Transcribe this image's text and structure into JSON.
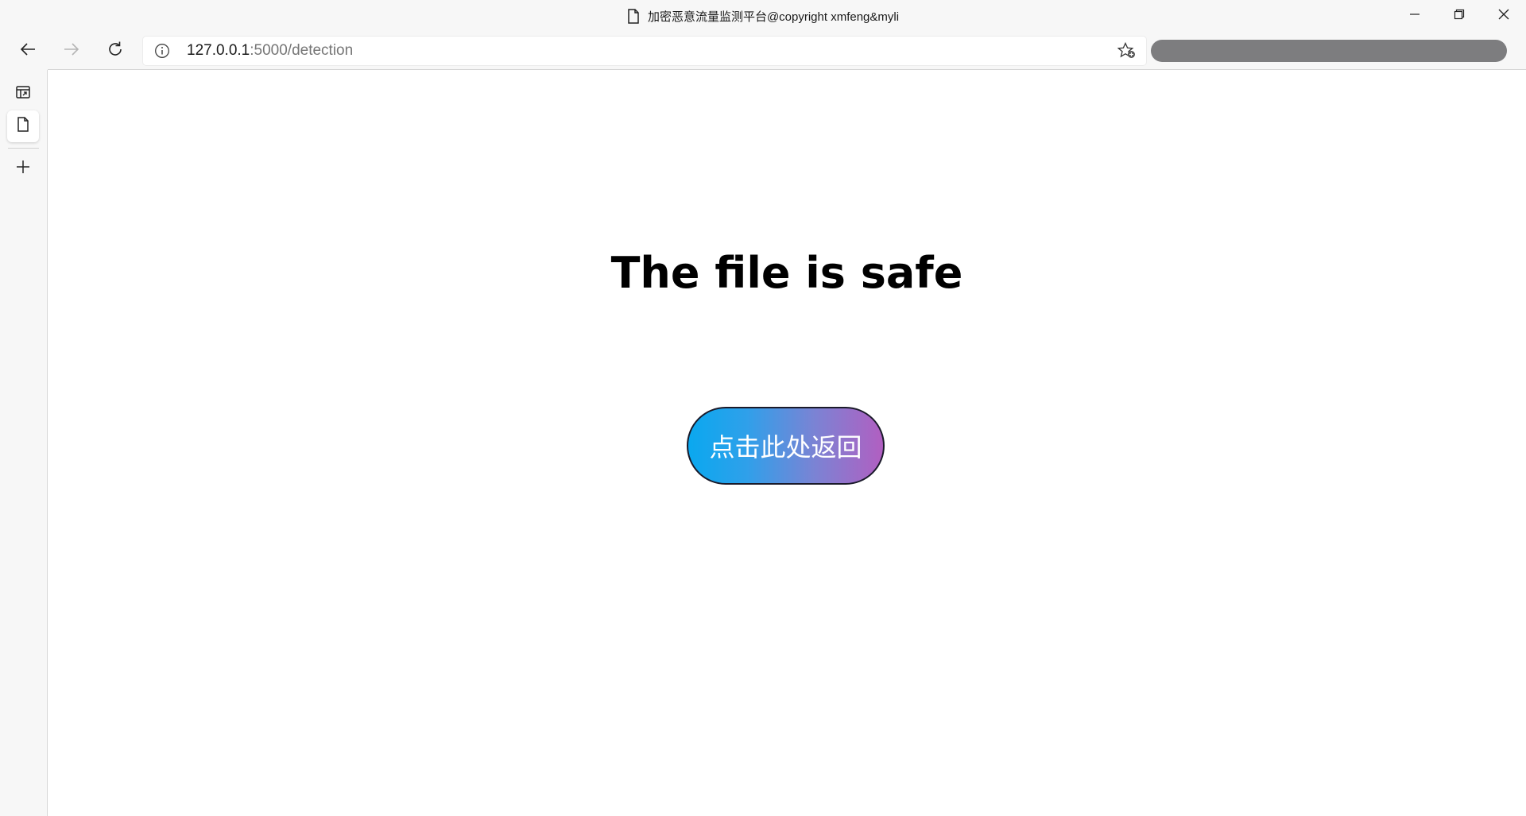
{
  "window": {
    "title": "加密恶意流量监测平台@copyright xmfeng&myli",
    "page_icon": "document-icon",
    "controls": [
      "minimize-icon",
      "restore-icon",
      "close-icon"
    ]
  },
  "toolbar": {
    "back_icon": "arrow-left-icon",
    "forward_icon": "arrow-right-icon",
    "refresh_icon": "refresh-icon",
    "address": {
      "host": "127.0.0.1",
      "rest": ":5000/detection",
      "info_icon": "info-icon",
      "favorite_icon": "add-favorite-icon"
    }
  },
  "sidebar": {
    "items": [
      {
        "icon": "tab-actions-icon"
      },
      {
        "icon": "document-icon",
        "active": true
      },
      {
        "icon": "plus-icon"
      }
    ]
  },
  "page": {
    "heading": "The file is safe",
    "button_label": "点击此处返回",
    "button_gradient": [
      "#0aa8ef",
      "#b15fc1"
    ]
  }
}
